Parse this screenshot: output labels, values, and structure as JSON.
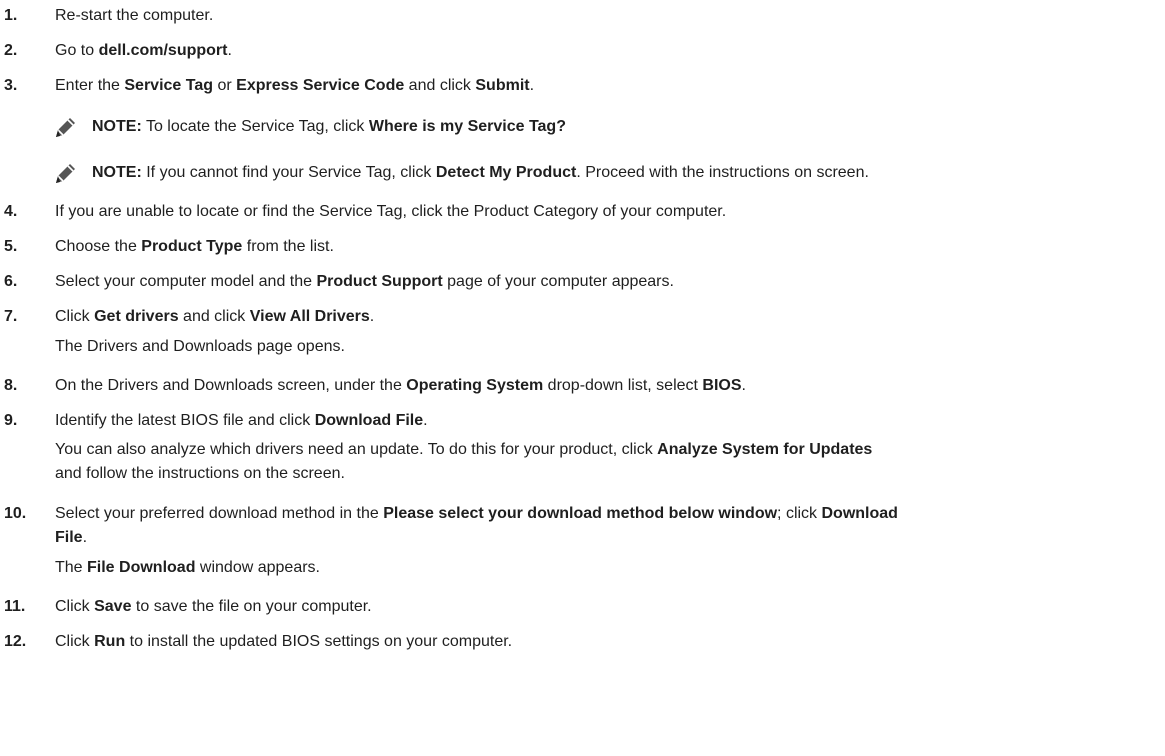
{
  "steps": [
    {
      "num": "1.",
      "parts": [
        "Re-start the computer."
      ]
    },
    {
      "num": "2.",
      "parts": [
        "Go to ",
        "dell.com/support",
        "."
      ]
    },
    {
      "num": "3.",
      "parts": [
        "Enter the ",
        "Service Tag",
        " or ",
        "Express Service Code",
        " and click ",
        "Submit",
        "."
      ]
    },
    {
      "num": "4.",
      "parts": [
        "If you are unable to locate or find the Service Tag, click the Product Category of your computer."
      ]
    },
    {
      "num": "5.",
      "parts": [
        "Choose the ",
        "Product Type",
        " from the list."
      ]
    },
    {
      "num": "6.",
      "parts": [
        "Select your computer model and the ",
        "Product Support",
        " page of your computer appears."
      ]
    },
    {
      "num": "7.",
      "parts": [
        "Click ",
        "Get drivers",
        " and click ",
        "View All Drivers",
        "."
      ]
    },
    {
      "num": "8.",
      "parts": [
        "On the Drivers and Downloads screen, under the ",
        "Operating System",
        " drop-down list, select ",
        "BIOS",
        "."
      ]
    },
    {
      "num": "9.",
      "parts": [
        "Identify the latest BIOS file and click ",
        "Download File",
        "."
      ]
    },
    {
      "num": "10.",
      "parts": [
        "Select your preferred download method in the ",
        "Please select your download method below window",
        "; click ",
        "Download"
      ]
    },
    {
      "num": "11.",
      "parts": [
        "Click ",
        "Save",
        " to save the file on your computer."
      ]
    },
    {
      "num": "12.",
      "parts": [
        "Click ",
        "Run",
        " to install the updated BIOS settings on your computer."
      ]
    }
  ],
  "notes": [
    {
      "parts": [
        "NOTE:",
        " To locate the Service Tag, click ",
        "Where is my Service Tag?"
      ]
    },
    {
      "parts": [
        "NOTE:",
        " If you cannot find your Service Tag, click ",
        "Detect My Product",
        ". Proceed with the instructions on screen."
      ]
    }
  ],
  "continuations": {
    "step7": [
      "The Drivers and Downloads page opens."
    ],
    "step9_line1": [
      "You can also analyze which drivers need an update. To do this for your product, click ",
      "Analyze System for Updates"
    ],
    "step9_line2": [
      "and follow the instructions on the screen."
    ],
    "step10_line2": [
      "File",
      "."
    ],
    "step10_line3": [
      "The ",
      "File Download",
      " window appears."
    ]
  },
  "colors": {
    "text": "#1f1f1f",
    "note_icon": "#555555"
  }
}
